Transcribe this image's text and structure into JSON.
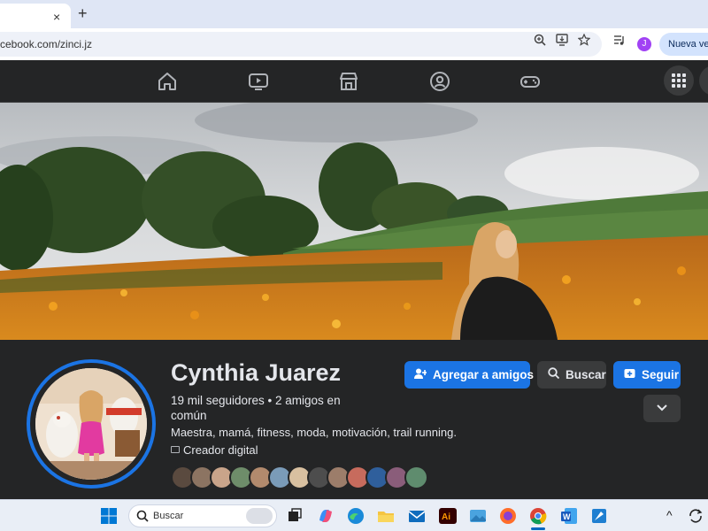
{
  "browser": {
    "tab_close": "×",
    "new_tab": "+",
    "url": "cebook.com/zinci.jz",
    "profile_initial": "J",
    "new_version_label": "Nueva vers",
    "url_icons": [
      "zoom-icon",
      "install-icon",
      "star-icon",
      "media-icon"
    ]
  },
  "nav": {
    "icons": [
      "home-icon",
      "watch-icon",
      "marketplace-icon",
      "groups-icon",
      "gaming-icon"
    ]
  },
  "profile": {
    "name": "Cynthia Juarez",
    "stats": "19 mil seguidores • 2 amigos en común",
    "bio": "Maestra, mamá, fitness, moda, motivación, trail running.",
    "category": "Creador digital",
    "buttons": {
      "add_friend": "Agregar a amigos",
      "search": "Buscar",
      "follow": "Seguir"
    },
    "friend_avatar_colors": [
      "#5a4a3f",
      "#8c7462",
      "#c9a48a",
      "#6e8d6a",
      "#b28a6d",
      "#7a9bb8",
      "#d8c0a0",
      "#4d4d4d",
      "#9c7d6a",
      "#c76b5d",
      "#2f5f9c",
      "#8a5d7a",
      "#5f8c6e"
    ]
  },
  "taskbar": {
    "search_placeholder": "Buscar",
    "chevron_label": "^",
    "apps": [
      "windows-start-icon",
      "task-view-icon",
      "copilot-icon",
      "edge-icon",
      "file-explorer-icon",
      "mail-icon",
      "illustrator-icon",
      "photos-icon",
      "firefox-icon",
      "chrome-icon",
      "word-icon",
      "paint-icon"
    ]
  },
  "colors": {
    "accent": "#1b74e4",
    "background": "#242526",
    "secondary_button": "#3a3b3c",
    "text": "#e4e6eb"
  }
}
